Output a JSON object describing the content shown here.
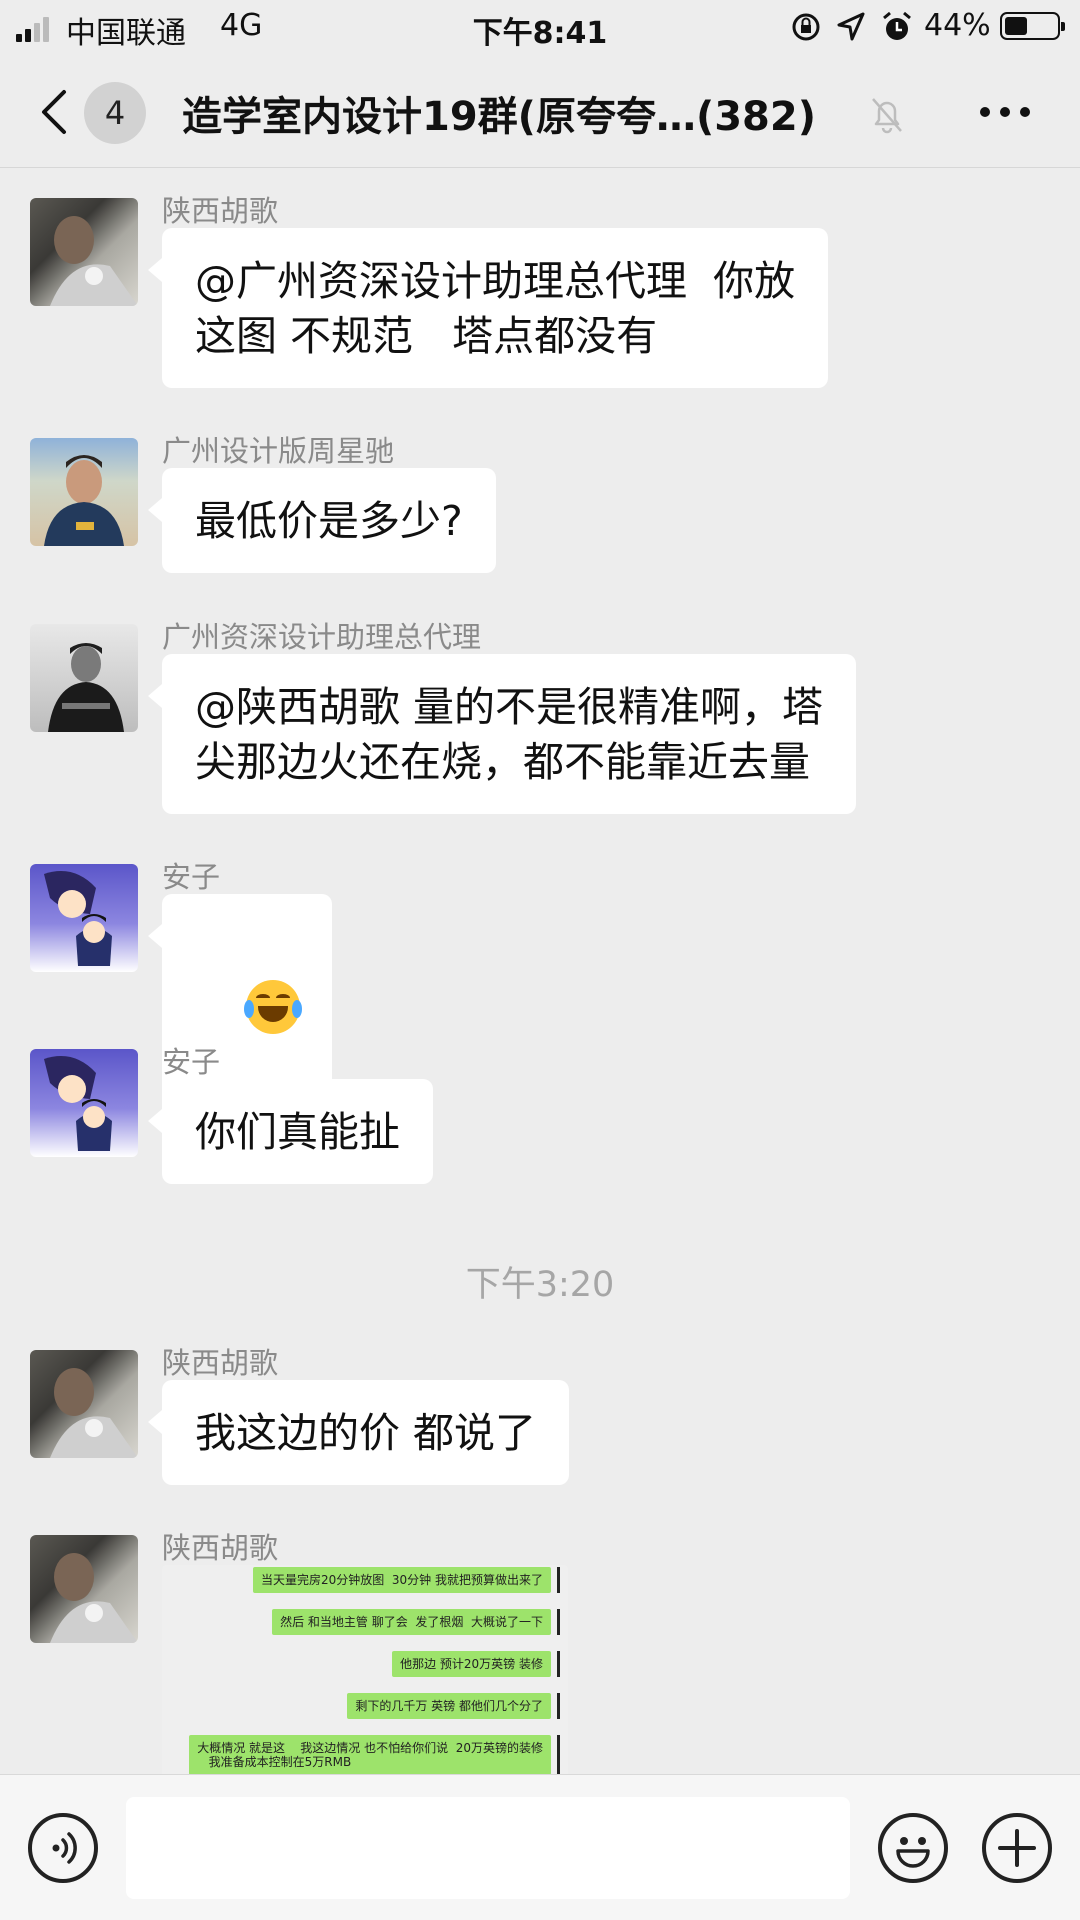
{
  "status_bar": {
    "carrier": "中国联通",
    "network": "4G",
    "time": "下午8:41",
    "battery_pct": "44%",
    "battery_level": 0.44
  },
  "nav": {
    "unread_count": "4",
    "title": "造学室内设计19群(原夸夸…(382)"
  },
  "messages": [
    {
      "sender": "陕西胡歌",
      "text": "@广州资深设计助理总代理  你放\n这图 不规范   塔点都没有"
    },
    {
      "sender": "广州设计版周星驰",
      "text": "最低价是多少?"
    },
    {
      "sender": "广州资深设计助理总代理",
      "text": "@陕西胡歌 量的不是很精准啊，塔\n尖那边火还在烧，都不能靠近去量"
    },
    {
      "sender": "安子",
      "emoji": "face-with-tears-of-joy"
    },
    {
      "sender": "安子",
      "text": "你们真能扯"
    }
  ],
  "timestamp": "下午3:20",
  "messages_after": [
    {
      "sender": "陕西胡歌",
      "text": "我这边的价 都说了"
    },
    {
      "sender": "陕西胡歌",
      "image_lines": [
        "当天量完房20分钟放图  30分钟 我就把预算做出来了",
        "然后 和当地主管 聊了会  发了根烟  大概说了一下",
        "他那边 预计20万英镑 装修",
        "剩下的几千万 英镑 都他们几个分了",
        "大概情况 就是这    我这边情况 也不怕给你们说  20万英镑的装修\n   我准备成本控制在5万RMB"
      ]
    }
  ],
  "input_bar": {
    "input_value": ""
  }
}
